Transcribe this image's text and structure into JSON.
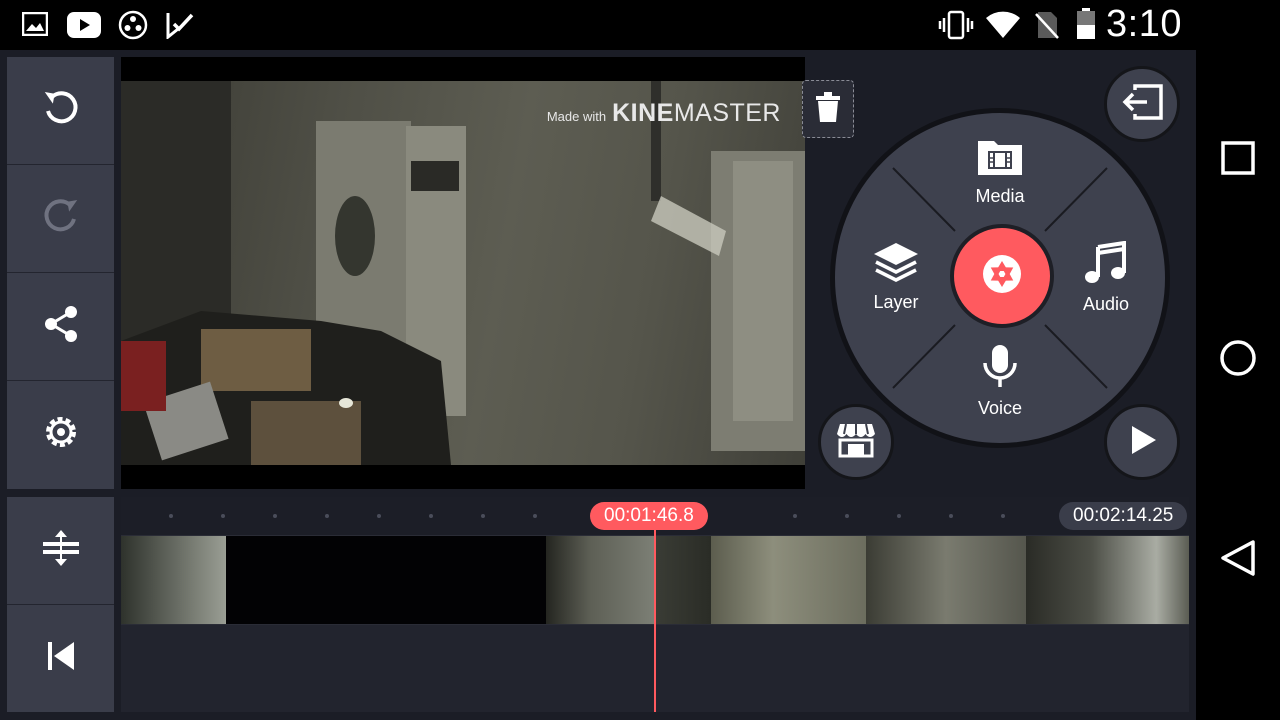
{
  "status_bar": {
    "time": "3:10",
    "left_icons": [
      "gallery-icon",
      "youtube-icon",
      "app-icon",
      "check-notification-icon"
    ],
    "right_icons": [
      "vibrate-icon",
      "wifi-icon",
      "no-sim-icon",
      "battery-icon"
    ]
  },
  "preview": {
    "watermark": {
      "prefix": "Made with",
      "brand_bold": "KINE",
      "brand_light": "MASTER"
    }
  },
  "left_toolbar": {
    "items": [
      "undo-icon",
      "redo-icon",
      "share-icon",
      "settings-icon"
    ],
    "bottom_items": [
      "expand-timeline-icon",
      "skip-to-start-icon"
    ]
  },
  "menu": {
    "media_label": "Media",
    "layer_label": "Layer",
    "audio_label": "Audio",
    "voice_label": "Voice"
  },
  "timeline": {
    "playhead_time": "00:01:46.8",
    "total_time": "00:02:14.25"
  },
  "colors": {
    "accent": "#ff5a5f",
    "panel": "#3a3d4a",
    "background": "#1b1d26"
  }
}
